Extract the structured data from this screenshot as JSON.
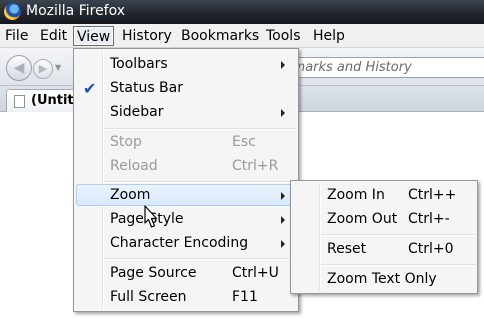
{
  "window": {
    "title": "Mozilla Firefox"
  },
  "menubar": [
    {
      "label": "File"
    },
    {
      "label": "Edit"
    },
    {
      "label": "View"
    },
    {
      "label": "History"
    },
    {
      "label": "Bookmarks"
    },
    {
      "label": "Tools"
    },
    {
      "label": "Help"
    }
  ],
  "navbar": {
    "search_placeholder": "kmarks and History"
  },
  "tab": {
    "title": "(Untit"
  },
  "view_menu": {
    "items": [
      {
        "label": "Toolbars"
      },
      {
        "label": "Status Bar",
        "checked": true
      },
      {
        "label": "Sidebar"
      },
      {
        "label": "Stop",
        "shortcut": "Esc",
        "disabled": true
      },
      {
        "label": "Reload",
        "shortcut": "Ctrl+R",
        "disabled": true
      },
      {
        "label": "Zoom",
        "highlighted": true
      },
      {
        "label": "Page Style"
      },
      {
        "label": "Character Encoding"
      },
      {
        "label": "Page Source",
        "shortcut": "Ctrl+U"
      },
      {
        "label": "Full Screen",
        "shortcut": "F11"
      }
    ]
  },
  "zoom_menu": {
    "items": [
      {
        "label": "Zoom In",
        "shortcut": "Ctrl++"
      },
      {
        "label": "Zoom Out",
        "shortcut": "Ctrl+-"
      },
      {
        "label": "Reset",
        "shortcut": "Ctrl+0"
      },
      {
        "label": "Zoom Text Only"
      }
    ]
  },
  "colors": {
    "highlight": "#d9e9fb",
    "check": "#1d4fb6",
    "titlebar": "#22272f"
  }
}
